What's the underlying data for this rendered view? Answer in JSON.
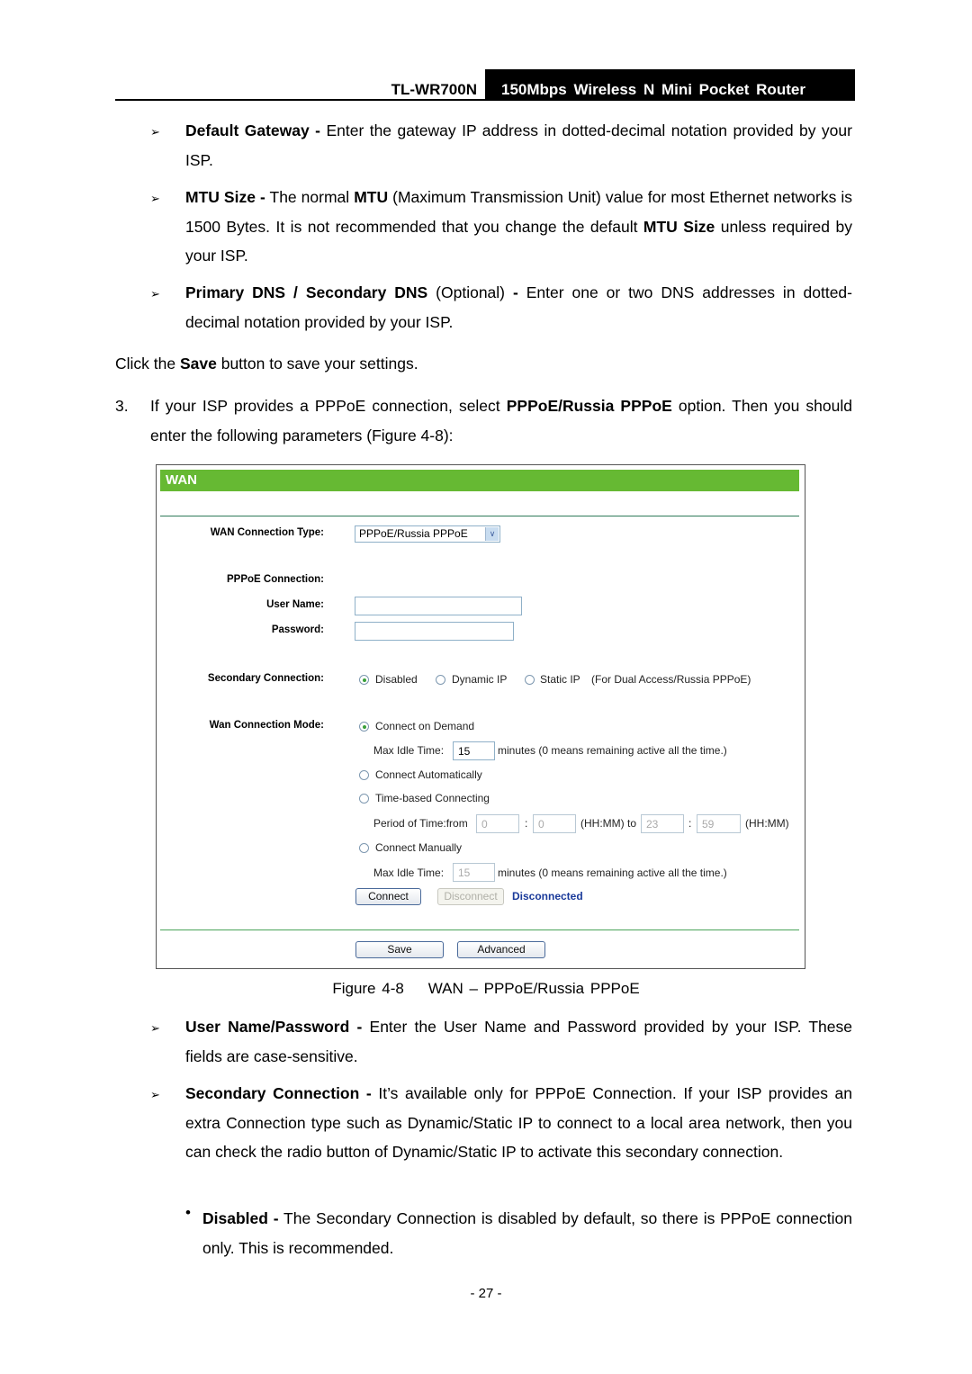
{
  "header": {
    "model": "TL-WR700N",
    "product_title": "150Mbps Wireless N Mini Pocket Router"
  },
  "bullets_top": [
    {
      "term": "Default Gateway -",
      "text": " Enter the gateway IP address in dotted-decimal notation provided by your ISP."
    },
    {
      "term": "MTU Size -",
      "text_parts": [
        " The normal ",
        "MTU",
        " (Maximum Transmission Unit) value for most Ethernet networks is 1500 Bytes. It is not recommended that you change the default ",
        "MTU Size",
        " unless required by your ISP."
      ]
    },
    {
      "term": "Primary DNS / Secondary DNS",
      "text": " (Optional) ",
      "term2": "-",
      "text2": " Enter one or two DNS addresses in dotted-decimal notation provided by your ISP."
    }
  ],
  "save_instruction": {
    "before": "Click the ",
    "bold": "Save",
    "after": " button to save your settings."
  },
  "step3": {
    "number": "3.",
    "before": "If your ISP provides a PPPoE connection, select ",
    "bold": "PPPoE/Russia PPPoE",
    "after": " option. Then you should enter the following parameters (Figure 4-8):"
  },
  "figure": {
    "panel_title": "WAN",
    "wan_connection_type_label": "WAN Connection Type:",
    "wan_connection_type_value": "PPPoE/Russia PPPoE",
    "pppoe_connection_label": "PPPoE Connection:",
    "user_name_label": "User Name:",
    "user_name_value": "",
    "password_label": "Password:",
    "password_value": "",
    "secondary_connection_label": "Secondary Connection:",
    "secondary_options": [
      {
        "label": "Disabled",
        "selected": true
      },
      {
        "label": "Dynamic IP",
        "selected": false
      },
      {
        "label": "Static IP",
        "selected": false
      }
    ],
    "secondary_note": "(For Dual Access/Russia PPPoE)",
    "wan_connection_mode_label": "Wan Connection Mode:",
    "mode_connect_on_demand": "Connect on Demand",
    "max_idle_label": "Max Idle Time:",
    "max_idle_value_demand": "15",
    "max_idle_note": "minutes (0 means remaining active all the time.)",
    "mode_connect_automatically": "Connect Automatically",
    "mode_time_based": "Time-based Connecting",
    "period_label": "Period of Time:from",
    "period_from_hh": "0",
    "period_from_mm": "0",
    "period_sep": ":",
    "period_hhmm_to": "(HH:MM) to",
    "period_to_hh": "23",
    "period_to_mm": "59",
    "period_hhmm": "(HH:MM)",
    "mode_connect_manually": "Connect Manually",
    "max_idle_value_manual": "15",
    "connect_button": "Connect",
    "disconnect_button": "Disconnect",
    "status": "Disconnected",
    "save_button": "Save",
    "advanced_button": "Advanced",
    "colors": {
      "header_green": "#66b933",
      "status_blue": "#1a3a9a"
    }
  },
  "caption": "Figure 4-8    WAN – PPPoE/Russia PPPoE",
  "bullets_bottom": [
    {
      "term": "User Name/Password -",
      "text": " Enter the User Name and Password provided by your ISP. These fields are case-sensitive."
    },
    {
      "term": "Secondary Connection -",
      "text": " It’s available only for PPPoE Connection. If your ISP provides an extra Connection type such as Dynamic/Static IP to connect to a local area network, then you can check the radio button of Dynamic/Static IP to activate this secondary connection."
    }
  ],
  "sub_bullet": {
    "term": "Disabled -",
    "text": " The Secondary Connection is disabled by default, so there is PPPoE connection only. This is recommended."
  },
  "page_number": "- 27 -"
}
